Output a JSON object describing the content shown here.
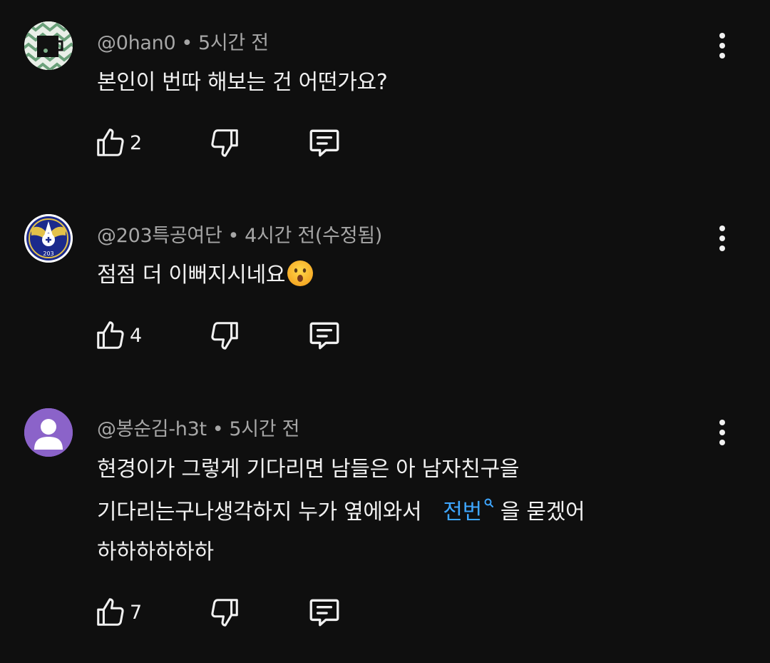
{
  "comments": [
    {
      "handle": "@0han0",
      "time": "5시간 전",
      "text_lines": [
        "본인이 번따 해보는 건 어떤가요?"
      ],
      "likes": "2",
      "avatar": "pattern-avatar"
    },
    {
      "handle": "@203특공여단",
      "time": "4시간 전(수정됨)",
      "text_lines": [
        "점점 더 이뻐지시네요"
      ],
      "emoji": "surprised-face-emoji",
      "likes": "4",
      "avatar": "emblem-avatar",
      "avatar_badge": "203"
    },
    {
      "handle": "@봉순김-h3t",
      "time": "5시간 전",
      "text_lines": [
        "현경이가  그렇게  기다리면  남들은  아  남자친구을",
        "기다리는구나생각하지  누가  옆에와서",
        "을  묻겠어",
        "하하하하하하"
      ],
      "link_text": "전번",
      "likes": "7",
      "avatar": "default-person-avatar"
    }
  ],
  "colors": {
    "background": "#0f0f0f",
    "primary_text": "#f1f1f1",
    "secondary_text": "#a6a6a6",
    "link": "#3ea6ff",
    "avatar_purple": "#8b63c9"
  },
  "icons": {
    "like": "thumbs-up-icon",
    "dislike": "thumbs-down-icon",
    "reply": "reply-icon",
    "more": "more-vertical-icon",
    "search": "search-icon"
  }
}
